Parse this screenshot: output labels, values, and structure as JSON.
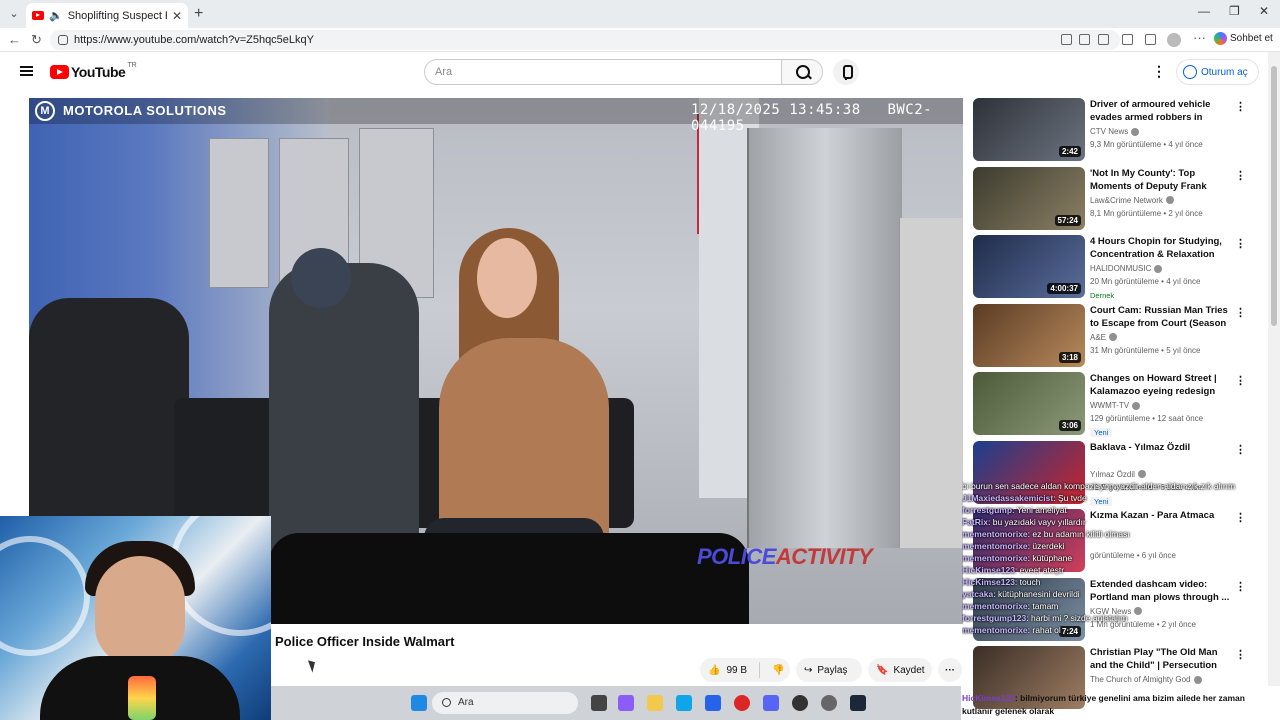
{
  "browser": {
    "tab_title": "Shoplifting Suspect Pulls Gun",
    "url": "https://www.youtube.com/watch?v=Z5hqc5eLkqY",
    "chat_button": "Sohbet et"
  },
  "header": {
    "logo_text": "YouTube",
    "country_code": "TR",
    "search_placeholder": "Ara",
    "signin_label": "Oturum aç"
  },
  "player": {
    "brand": "MOTOROLA SOLUTIONS",
    "timestamp": "12/18/2025 13:45:38",
    "camera_id": "BWC2-044195",
    "watermark_a": "POLICE",
    "watermark_b": "ACTIVITY"
  },
  "video": {
    "title": "Police Officer Inside Walmart",
    "likes": "99 B",
    "share_label": "Paylaş",
    "save_label": "Kaydet"
  },
  "related": [
    {
      "title": "Driver of armoured vehicle evades armed robbers in braz...",
      "channel": "CTV News",
      "views": "9,3 Mn görüntüleme",
      "age": "4 yıl önce",
      "duration": "2:42",
      "badge": "",
      "colors": [
        "#2d3138",
        "#6d7480"
      ]
    },
    {
      "title": "'Not In My County': Top Moments of Deputy Frank Slo...",
      "channel": "Law&Crime Network",
      "views": "8,1 Mn görüntüleme",
      "age": "2 yıl önce",
      "duration": "57:24",
      "badge": "",
      "colors": [
        "#3c3b2f",
        "#8c8063"
      ]
    },
    {
      "title": "4 Hours Chopin for Studying, Concentration & Relaxation",
      "channel": "HALIDONMUSIC",
      "views": "20 Mn görüntüleme",
      "age": "4 yıl önce",
      "duration": "4:00:37",
      "badge": "Dernek",
      "colors": [
        "#1f2b4a",
        "#5a6e9c"
      ]
    },
    {
      "title": "Court Cam: Russian Man Tries to Escape from Court (Season ...",
      "channel": "A&E",
      "views": "31 Mn görüntüleme",
      "age": "5 yıl önce",
      "duration": "3:18",
      "badge": "",
      "colors": [
        "#5a3b23",
        "#b88a5c"
      ]
    },
    {
      "title": "Changes on Howard Street | Kalamazoo eyeing redesign on...",
      "channel": "WWMT-TV",
      "views": "129 görüntüleme",
      "age": "12 saat önce",
      "duration": "3:06",
      "badge": "Yeni",
      "colors": [
        "#4d5a3a",
        "#8c9a7a"
      ]
    },
    {
      "title": "Baklava - Yılmaz Özdil",
      "channel": "Yılmaz Özdil",
      "views": "41 B görüntüleme",
      "age": "6 saat önce",
      "duration": "",
      "badge": "Yeni",
      "colors": [
        "#1a3f8f",
        "#c9242b"
      ]
    },
    {
      "title": "Kızma Kazan - Para Atmaca",
      "channel": "",
      "views": "görüntüleme",
      "age": "6 yıl önce",
      "duration": "",
      "badge": "",
      "colors": [
        "#2b2a6b",
        "#d23f5a"
      ]
    },
    {
      "title": "Extended dashcam video: Portland man plows through ...",
      "channel": "KGW News",
      "views": "1 Mn görüntüleme",
      "age": "2 yıl önce",
      "duration": "7:24",
      "badge": "",
      "colors": [
        "#2e3a4a",
        "#7d8fa3"
      ]
    },
    {
      "title": "Christian Play \"The Old Man and the Child\" | Persecution and ...",
      "channel": "The Church of Almighty God",
      "views": "",
      "age": "",
      "duration": "",
      "badge": "",
      "colors": [
        "#3a2e26",
        "#9e7d62"
      ]
    }
  ],
  "chat": [
    {
      "user": "",
      "text": "bi burun sen sadece aldan kompazisyon yazdir aldan aldan zık zık alırım"
    },
    {
      "user": "J1Maxiedassakemicist",
      "text": "Şu tvde"
    },
    {
      "user": "forrestgump",
      "text": "Yeni ameliyat"
    },
    {
      "user": "FatRix",
      "text": "bu yazıdaki vayv yıllardır"
    },
    {
      "user": "mementomorixe",
      "text": "ez bu adamın kilitli olması"
    },
    {
      "user": "mementomorixe",
      "text": "üzerdeki"
    },
    {
      "user": "mementomorixe",
      "text": "kütüphane"
    },
    {
      "user": "HicKimse123",
      "text": "eveet ateştr"
    },
    {
      "user": "HicKimse123",
      "text": "touch"
    },
    {
      "user": "yatcaka",
      "text": "kütüphanesini devrildi"
    },
    {
      "user": "mementomorixe",
      "text": "tamam"
    },
    {
      "user": "forrestgump123",
      "text": "harbi mi ? sizde anlatalım"
    },
    {
      "user": "mementomorixe",
      "text": "rahat ol"
    }
  ],
  "last_chat": {
    "user": "HicKimse123",
    "text": "bilmiyorum türkiye genelini ama bizim ailede her zaman kutlanır gelenek olarak"
  },
  "taskbar": {
    "search_label": "Ara"
  },
  "icons": {
    "tab_mute": "speaker-icon",
    "search": "search-icon",
    "mic": "microphone-icon",
    "like": "thumbs-up-icon",
    "dislike": "thumbs-down-icon",
    "share": "share-icon",
    "save": "bookmark-icon",
    "more": "more-icon"
  }
}
